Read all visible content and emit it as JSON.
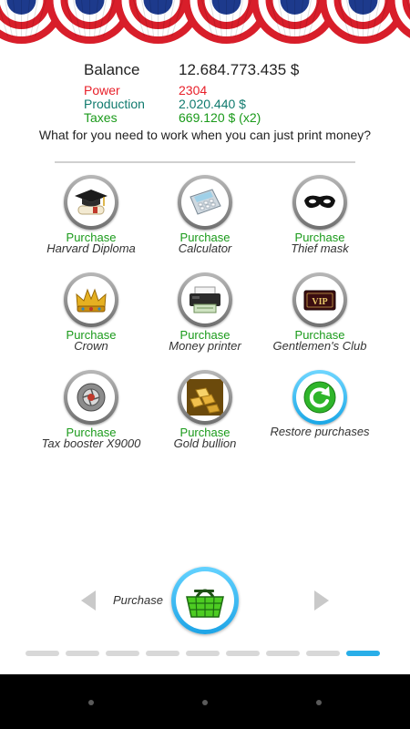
{
  "stats": {
    "balance_label": "Balance",
    "balance_value": "12.684.773.435 $",
    "power_label": "Power",
    "power_value": "2304",
    "production_label": "Production",
    "production_value": "2.020.440 $",
    "taxes_label": "Taxes",
    "taxes_value": "669.120 $ (x2)"
  },
  "colors": {
    "power": "#e8202a",
    "production": "#107a6e",
    "taxes": "#1a9a1a",
    "accent": "#29aee8",
    "bunting_red": "#d81e2a",
    "bunting_blue": "#1d3a8c"
  },
  "slogan": "What for you need to work when you can just print money?",
  "items": [
    {
      "action": "Purchase",
      "name": "Harvard Diploma",
      "icon": "graduation-cap-icon"
    },
    {
      "action": "Purchase",
      "name": "Calculator",
      "icon": "calculator-icon"
    },
    {
      "action": "Purchase",
      "name": "Thief mask",
      "icon": "thief-mask-icon"
    },
    {
      "action": "Purchase",
      "name": "Crown",
      "icon": "crown-icon"
    },
    {
      "action": "Purchase",
      "name": "Money printer",
      "icon": "printer-icon"
    },
    {
      "action": "Purchase",
      "name": "Gentlemen's Club",
      "icon": "vip-card-icon"
    },
    {
      "action": "Purchase",
      "name": "Tax booster X9000",
      "icon": "turbo-booster-icon"
    },
    {
      "action": "Purchase",
      "name": "Gold bullion",
      "icon": "gold-bars-icon"
    },
    {
      "action": "",
      "name": "Restore purchases",
      "icon": "restore-icon"
    }
  ],
  "bottom": {
    "label": "Purchase",
    "basket_icon": "shopping-basket-icon"
  },
  "pager": {
    "total": 9,
    "active": 8
  }
}
